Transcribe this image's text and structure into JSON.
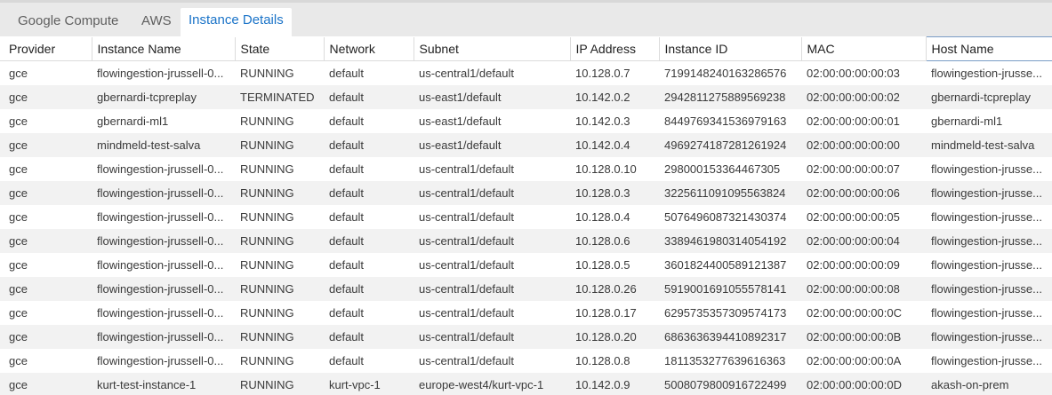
{
  "tabs": [
    {
      "label": "Google Compute"
    },
    {
      "label": "AWS"
    },
    {
      "label": "Instance Details",
      "active": true
    }
  ],
  "table": {
    "columns": [
      "Provider",
      "Instance Name",
      "State",
      "Network",
      "Subnet",
      "IP Address",
      "Instance ID",
      "MAC",
      "Host Name"
    ],
    "rows": [
      [
        "gce",
        "flowingestion-jrussell-0...",
        "RUNNING",
        "default",
        "us-central1/default",
        "10.128.0.7",
        "7199148240163286576",
        "02:00:00:00:00:03",
        "flowingestion-jrusse..."
      ],
      [
        "gce",
        "gbernardi-tcpreplay",
        "TERMINATED",
        "default",
        "us-east1/default",
        "10.142.0.2",
        "2942811275889569238",
        "02:00:00:00:00:02",
        "gbernardi-tcpreplay"
      ],
      [
        "gce",
        "gbernardi-ml1",
        "RUNNING",
        "default",
        "us-east1/default",
        "10.142.0.3",
        "8449769341536979163",
        "02:00:00:00:00:01",
        "gbernardi-ml1"
      ],
      [
        "gce",
        "mindmeld-test-salva",
        "RUNNING",
        "default",
        "us-east1/default",
        "10.142.0.4",
        "4969274187281261924",
        "02:00:00:00:00:00",
        "mindmeld-test-salva"
      ],
      [
        "gce",
        "flowingestion-jrussell-0...",
        "RUNNING",
        "default",
        "us-central1/default",
        "10.128.0.10",
        "298000153364467305",
        "02:00:00:00:00:07",
        "flowingestion-jrusse..."
      ],
      [
        "gce",
        "flowingestion-jrussell-0...",
        "RUNNING",
        "default",
        "us-central1/default",
        "10.128.0.3",
        "3225611091095563824",
        "02:00:00:00:00:06",
        "flowingestion-jrusse..."
      ],
      [
        "gce",
        "flowingestion-jrussell-0...",
        "RUNNING",
        "default",
        "us-central1/default",
        "10.128.0.4",
        "5076496087321430374",
        "02:00:00:00:00:05",
        "flowingestion-jrusse..."
      ],
      [
        "gce",
        "flowingestion-jrussell-0...",
        "RUNNING",
        "default",
        "us-central1/default",
        "10.128.0.6",
        "3389461980314054192",
        "02:00:00:00:00:04",
        "flowingestion-jrusse..."
      ],
      [
        "gce",
        "flowingestion-jrussell-0...",
        "RUNNING",
        "default",
        "us-central1/default",
        "10.128.0.5",
        "3601824400589121387",
        "02:00:00:00:00:09",
        "flowingestion-jrusse..."
      ],
      [
        "gce",
        "flowingestion-jrussell-0...",
        "RUNNING",
        "default",
        "us-central1/default",
        "10.128.0.26",
        "5919001691055578141",
        "02:00:00:00:00:08",
        "flowingestion-jrusse..."
      ],
      [
        "gce",
        "flowingestion-jrussell-0...",
        "RUNNING",
        "default",
        "us-central1/default",
        "10.128.0.17",
        "6295735357309574173",
        "02:00:00:00:00:0C",
        "flowingestion-jrusse..."
      ],
      [
        "gce",
        "flowingestion-jrussell-0...",
        "RUNNING",
        "default",
        "us-central1/default",
        "10.128.0.20",
        "6863636394410892317",
        "02:00:00:00:00:0B",
        "flowingestion-jrusse..."
      ],
      [
        "gce",
        "flowingestion-jrussell-0...",
        "RUNNING",
        "default",
        "us-central1/default",
        "10.128.0.8",
        "1811353277639616363",
        "02:00:00:00:00:0A",
        "flowingestion-jrusse..."
      ],
      [
        "gce",
        "kurt-test-instance-1",
        "RUNNING",
        "kurt-vpc-1",
        "europe-west4/kurt-vpc-1",
        "10.142.0.9",
        "5008079800916722499",
        "02:00:00:00:00:0D",
        "akash-on-prem"
      ]
    ]
  },
  "colors": {
    "tab_active_text": "#1a73c8",
    "tab_text": "#5f5f5f",
    "tabbar_bg": "#e9e9e9",
    "row_alt_bg": "#f2f2f2",
    "sorted_header_border": "#7a9cc6"
  }
}
